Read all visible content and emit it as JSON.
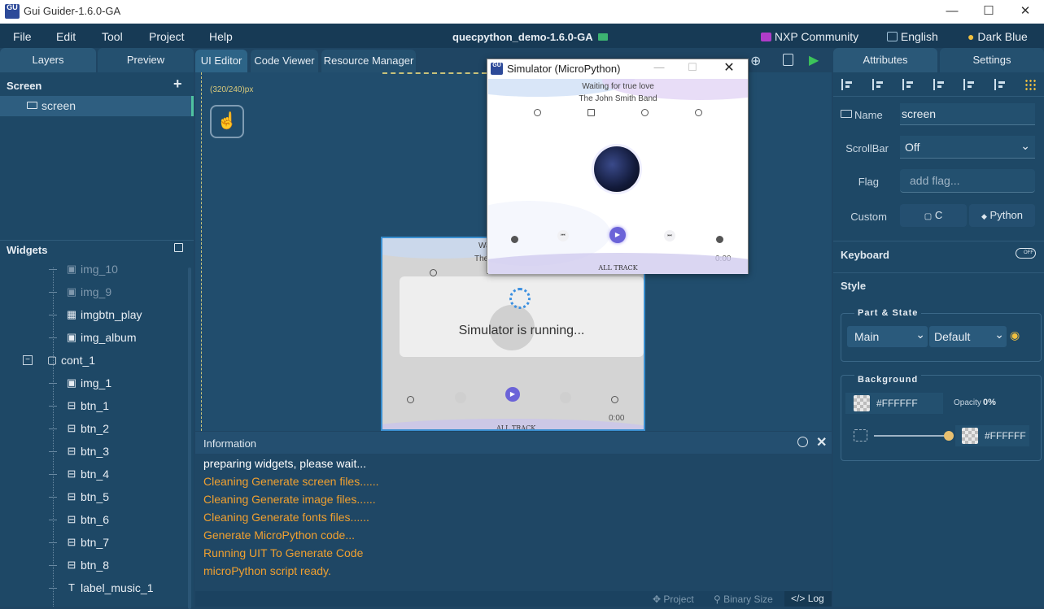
{
  "window": {
    "title": "Gui Guider-1.6.0-GA",
    "logo": "GU"
  },
  "menubar": {
    "items": [
      "File",
      "Edit",
      "Tool",
      "Project",
      "Help"
    ],
    "project": "quecpython_demo-1.6.0-GA",
    "community": "NXP Community",
    "language": "English",
    "theme": "Dark Blue"
  },
  "left_tabs": [
    "Layers",
    "Preview"
  ],
  "center_tabs": [
    "UI Editor",
    "Code Viewer",
    "Resource Manager"
  ],
  "screen_section": {
    "title": "Screen",
    "add": "+",
    "item": "screen"
  },
  "widgets": {
    "title": "Widgets",
    "items": [
      {
        "label": "img_10",
        "icon": "image-icon"
      },
      {
        "label": "img_9",
        "icon": "image-icon"
      },
      {
        "label": "imgbtn_play",
        "icon": "imgbtn-icon"
      },
      {
        "label": "img_album",
        "icon": "image-icon"
      },
      {
        "label": "cont_1",
        "icon": "container-icon"
      },
      {
        "label": "img_1",
        "icon": "image-icon"
      },
      {
        "label": "btn_1",
        "icon": "button-icon"
      },
      {
        "label": "btn_2",
        "icon": "button-icon"
      },
      {
        "label": "btn_3",
        "icon": "button-icon"
      },
      {
        "label": "btn_4",
        "icon": "button-icon"
      },
      {
        "label": "btn_5",
        "icon": "button-icon"
      },
      {
        "label": "btn_6",
        "icon": "button-icon"
      },
      {
        "label": "btn_7",
        "icon": "button-icon"
      },
      {
        "label": "btn_8",
        "icon": "button-icon"
      },
      {
        "label": "label_music_1",
        "icon": "text-icon"
      }
    ]
  },
  "canvas": {
    "size_label": "(320/240)px",
    "running_text": "Simulator is running..."
  },
  "simulator": {
    "title": "Simulator (MicroPython)",
    "song": "Waiting for true love",
    "artist": "The John Smith Band",
    "footer": "ALL TRACK",
    "time": "0:00"
  },
  "design_preview": {
    "song_fragment": "Wa",
    "artist_fragment": "The",
    "time": "0:00",
    "footer": "ALL TRACK"
  },
  "info": {
    "title": "Information",
    "lines": [
      {
        "text": "preparing widgets, please wait...",
        "color": "#ffffff"
      },
      {
        "text": "Cleaning Generate screen files......",
        "color": "#f0a030"
      },
      {
        "text": "Cleaning Generate image files......",
        "color": "#f0a030"
      },
      {
        "text": "Cleaning Generate fonts files......",
        "color": "#f0a030"
      },
      {
        "text": "Generate MicroPython code...",
        "color": "#f0a030"
      },
      {
        "text": "Running UIT To Generate Code",
        "color": "#f0a030"
      },
      {
        "text": "microPython script ready.",
        "color": "#f0a030"
      }
    ],
    "footer_tabs": [
      "Project",
      "Binary Size",
      "Log"
    ]
  },
  "right_tabs": [
    "Attributes",
    "Settings"
  ],
  "attributes": {
    "name_label": "Name",
    "name_value": "screen",
    "scrollbar_label": "ScrollBar",
    "scrollbar_value": "Off",
    "flag_label": "Flag",
    "flag_placeholder": "add flag...",
    "custom_label": "Custom",
    "custom_c": "C",
    "custom_python": "Python",
    "keyboard": "Keyboard",
    "toggle": "OFF",
    "style": "Style",
    "part_state": "Part & State",
    "part": "Main",
    "state": "Default",
    "background": "Background",
    "bg_color": "#FFFFFF",
    "opacity_label": "Opacity",
    "opacity_value": "0%",
    "grad_color": "#FFFFFF"
  }
}
